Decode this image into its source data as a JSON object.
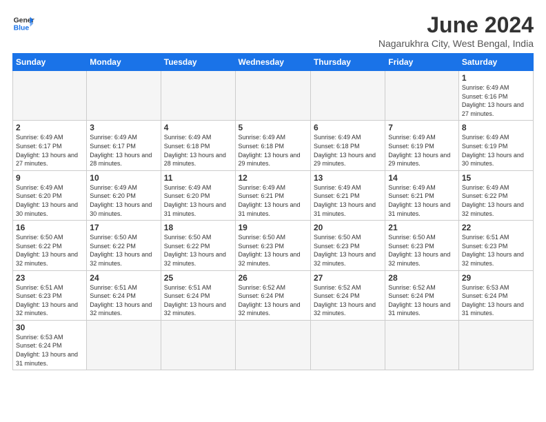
{
  "header": {
    "logo_general": "General",
    "logo_blue": "Blue",
    "title": "June 2024",
    "location": "Nagarukhra City, West Bengal, India"
  },
  "days_of_week": [
    "Sunday",
    "Monday",
    "Tuesday",
    "Wednesday",
    "Thursday",
    "Friday",
    "Saturday"
  ],
  "weeks": [
    [
      {
        "day": "",
        "info": ""
      },
      {
        "day": "",
        "info": ""
      },
      {
        "day": "",
        "info": ""
      },
      {
        "day": "",
        "info": ""
      },
      {
        "day": "",
        "info": ""
      },
      {
        "day": "",
        "info": ""
      },
      {
        "day": "1",
        "info": "Sunrise: 6:49 AM\nSunset: 6:16 PM\nDaylight: 13 hours\nand 27 minutes."
      }
    ],
    [
      {
        "day": "2",
        "info": "Sunrise: 6:49 AM\nSunset: 6:17 PM\nDaylight: 13 hours\nand 27 minutes."
      },
      {
        "day": "3",
        "info": "Sunrise: 6:49 AM\nSunset: 6:17 PM\nDaylight: 13 hours\nand 28 minutes."
      },
      {
        "day": "4",
        "info": "Sunrise: 6:49 AM\nSunset: 6:18 PM\nDaylight: 13 hours\nand 28 minutes."
      },
      {
        "day": "5",
        "info": "Sunrise: 6:49 AM\nSunset: 6:18 PM\nDaylight: 13 hours\nand 29 minutes."
      },
      {
        "day": "6",
        "info": "Sunrise: 6:49 AM\nSunset: 6:18 PM\nDaylight: 13 hours\nand 29 minutes."
      },
      {
        "day": "7",
        "info": "Sunrise: 6:49 AM\nSunset: 6:19 PM\nDaylight: 13 hours\nand 29 minutes."
      },
      {
        "day": "8",
        "info": "Sunrise: 6:49 AM\nSunset: 6:19 PM\nDaylight: 13 hours\nand 30 minutes."
      }
    ],
    [
      {
        "day": "9",
        "info": "Sunrise: 6:49 AM\nSunset: 6:20 PM\nDaylight: 13 hours\nand 30 minutes."
      },
      {
        "day": "10",
        "info": "Sunrise: 6:49 AM\nSunset: 6:20 PM\nDaylight: 13 hours\nand 30 minutes."
      },
      {
        "day": "11",
        "info": "Sunrise: 6:49 AM\nSunset: 6:20 PM\nDaylight: 13 hours\nand 31 minutes."
      },
      {
        "day": "12",
        "info": "Sunrise: 6:49 AM\nSunset: 6:21 PM\nDaylight: 13 hours\nand 31 minutes."
      },
      {
        "day": "13",
        "info": "Sunrise: 6:49 AM\nSunset: 6:21 PM\nDaylight: 13 hours\nand 31 minutes."
      },
      {
        "day": "14",
        "info": "Sunrise: 6:49 AM\nSunset: 6:21 PM\nDaylight: 13 hours\nand 31 minutes."
      },
      {
        "day": "15",
        "info": "Sunrise: 6:49 AM\nSunset: 6:22 PM\nDaylight: 13 hours\nand 32 minutes."
      }
    ],
    [
      {
        "day": "16",
        "info": "Sunrise: 6:50 AM\nSunset: 6:22 PM\nDaylight: 13 hours\nand 32 minutes."
      },
      {
        "day": "17",
        "info": "Sunrise: 6:50 AM\nSunset: 6:22 PM\nDaylight: 13 hours\nand 32 minutes."
      },
      {
        "day": "18",
        "info": "Sunrise: 6:50 AM\nSunset: 6:22 PM\nDaylight: 13 hours\nand 32 minutes."
      },
      {
        "day": "19",
        "info": "Sunrise: 6:50 AM\nSunset: 6:23 PM\nDaylight: 13 hours\nand 32 minutes."
      },
      {
        "day": "20",
        "info": "Sunrise: 6:50 AM\nSunset: 6:23 PM\nDaylight: 13 hours\nand 32 minutes."
      },
      {
        "day": "21",
        "info": "Sunrise: 6:50 AM\nSunset: 6:23 PM\nDaylight: 13 hours\nand 32 minutes."
      },
      {
        "day": "22",
        "info": "Sunrise: 6:51 AM\nSunset: 6:23 PM\nDaylight: 13 hours\nand 32 minutes."
      }
    ],
    [
      {
        "day": "23",
        "info": "Sunrise: 6:51 AM\nSunset: 6:23 PM\nDaylight: 13 hours\nand 32 minutes."
      },
      {
        "day": "24",
        "info": "Sunrise: 6:51 AM\nSunset: 6:24 PM\nDaylight: 13 hours\nand 32 minutes."
      },
      {
        "day": "25",
        "info": "Sunrise: 6:51 AM\nSunset: 6:24 PM\nDaylight: 13 hours\nand 32 minutes."
      },
      {
        "day": "26",
        "info": "Sunrise: 6:52 AM\nSunset: 6:24 PM\nDaylight: 13 hours\nand 32 minutes."
      },
      {
        "day": "27",
        "info": "Sunrise: 6:52 AM\nSunset: 6:24 PM\nDaylight: 13 hours\nand 32 minutes."
      },
      {
        "day": "28",
        "info": "Sunrise: 6:52 AM\nSunset: 6:24 PM\nDaylight: 13 hours\nand 31 minutes."
      },
      {
        "day": "29",
        "info": "Sunrise: 6:53 AM\nSunset: 6:24 PM\nDaylight: 13 hours\nand 31 minutes."
      }
    ],
    [
      {
        "day": "30",
        "info": "Sunrise: 6:53 AM\nSunset: 6:24 PM\nDaylight: 13 hours\nand 31 minutes."
      },
      {
        "day": "",
        "info": ""
      },
      {
        "day": "",
        "info": ""
      },
      {
        "day": "",
        "info": ""
      },
      {
        "day": "",
        "info": ""
      },
      {
        "day": "",
        "info": ""
      },
      {
        "day": "",
        "info": ""
      }
    ]
  ]
}
